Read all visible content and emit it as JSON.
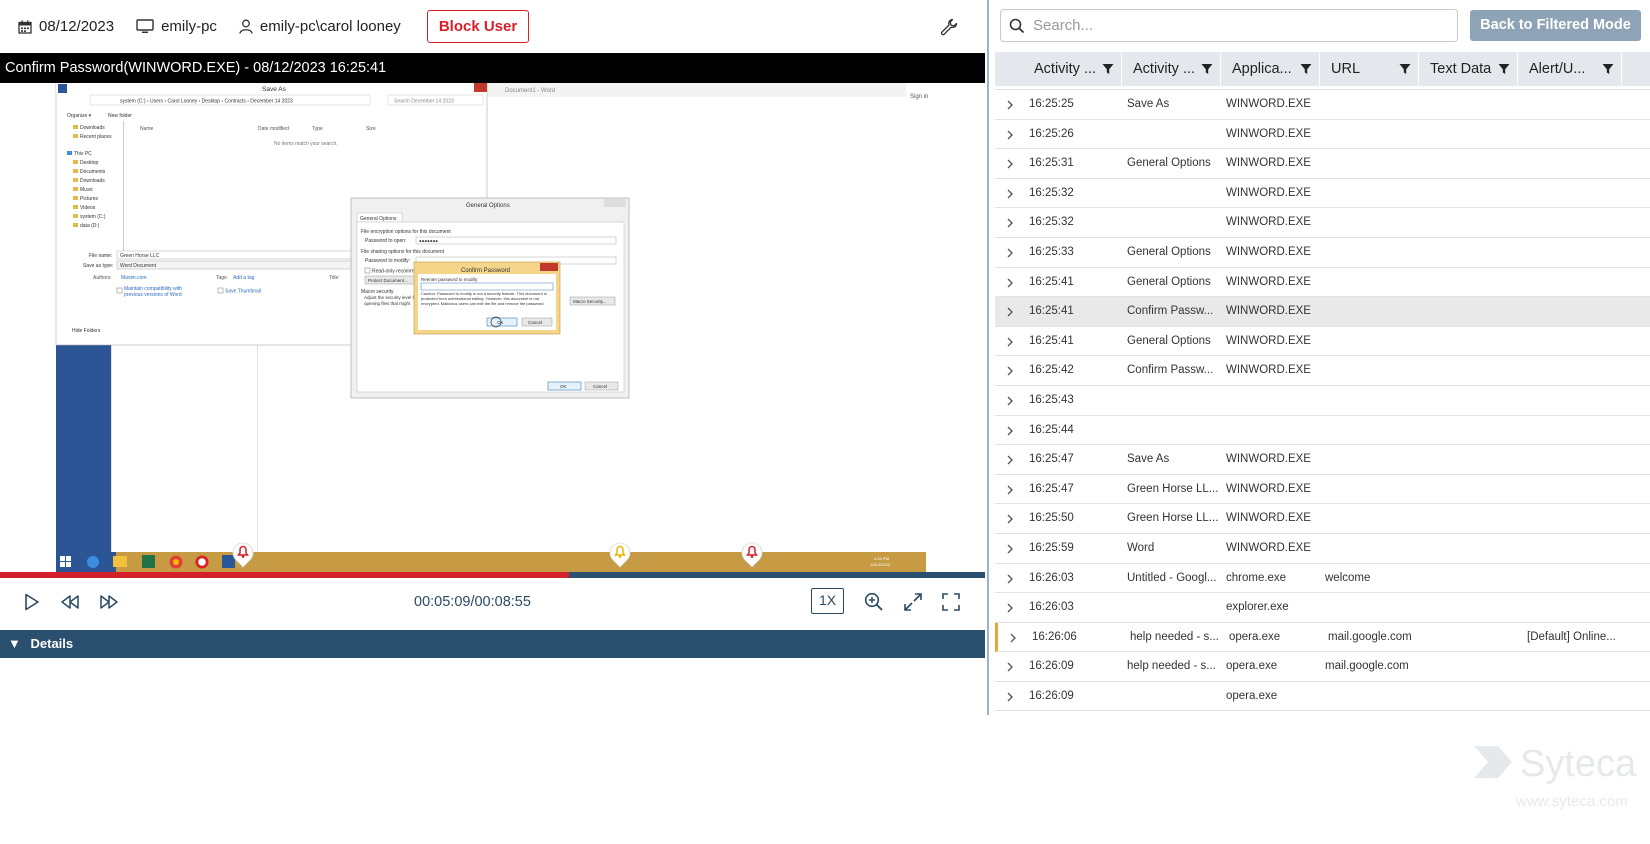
{
  "header": {
    "date": "08/12/2023",
    "computer": "emily-pc",
    "user": "emily-pc\\carol looney",
    "block_user_label": "Block User"
  },
  "player": {
    "title": "Confirm Password(WINWORD.EXE) - 08/12/2023 16:25:41",
    "timecode": "00:05:09/00:08:55",
    "progress_fraction": 0.578,
    "speed": "1X",
    "alert_markers_fraction": [
      0.247,
      0.629,
      0.763
    ]
  },
  "screenshot": {
    "saveas_title": "Save As",
    "path": "system (C:) › Users › Carol Looney › Desktop › Contracts › December 14 2023",
    "search_placeholder": "Search December 14 2023",
    "organize": "Organize ▾",
    "new_folder": "New folder",
    "col_name": "Name",
    "col_date": "Date modified",
    "col_type": "Type",
    "col_size": "Size",
    "empty": "No items match your search.",
    "nav": [
      "Downloads",
      "Recent places",
      "",
      "This PC",
      "Desktop",
      "Documents",
      "Downloads",
      "Music",
      "Pictures",
      "Videos",
      "system (C:)",
      "data (D:)"
    ],
    "file_name_label": "File name:",
    "file_name": "Green Horse LLC",
    "save_type_label": "Save as type:",
    "save_type": "Word Document",
    "authors_label": "Authors:",
    "authors": "Maxim.com",
    "tags_label": "Tags:",
    "tags": "Add a tag",
    "title_label": "Title:",
    "maintain": "Maintain compatibility with previous versions of Word",
    "thumb": "Save Thumbnail",
    "hide": "Hide Folders",
    "go_title": "General Options",
    "go_tab": "General Options",
    "go_enc": "File encryption options for this document",
    "go_pw_open": "Password to open:",
    "go_pw_dots": "●●●●●●●",
    "go_share": "File sharing options for this document",
    "go_pw_modify": "Password to modify:",
    "go_readonly": "Read-only recommended",
    "go_protect": "Protect Document...",
    "go_macro_head": "Macro security",
    "go_macro_text": "Adjust the security level for opening files that might contain macro viruses, and specify the names of trusted macro developers.",
    "go_macro_btn": "Macro Security...",
    "go_ok": "OK",
    "go_cancel": "Cancel",
    "cp_title": "Confirm Password",
    "cp_reenter": "Reenter password to modify:",
    "cp_caution": "Caution: Password to modify is not a security feature. This document is protected from unintentional editing. However, this document is not encrypted. Malicious users can edit the file and remove the password.",
    "cp_ok": "OK",
    "cp_cancel": "Cancel",
    "word_bg_text": "Document1 - Word",
    "signin": "Sign in",
    "tray_time": "4:25 PM",
    "tray_date": "12/14/2023"
  },
  "controls": {
    "details_label": "Details"
  },
  "right": {
    "search_placeholder": "Search...",
    "back_label": "Back to Filtered Mode",
    "columns": [
      "Activity ...",
      "Activity ...",
      "Applica...",
      "URL",
      "Text Data",
      "Alert/U..."
    ],
    "rows": [
      {
        "time": "16:25:25",
        "activity": "Save As",
        "app": "WINWORD.EXE",
        "url": "",
        "text": "",
        "alert": ""
      },
      {
        "time": "16:25:26",
        "activity": "",
        "app": "WINWORD.EXE",
        "url": "",
        "text": "",
        "alert": ""
      },
      {
        "time": "16:25:31",
        "activity": "General Options",
        "app": "WINWORD.EXE",
        "url": "",
        "text": "",
        "alert": ""
      },
      {
        "time": "16:25:32",
        "activity": "",
        "app": "WINWORD.EXE",
        "url": "",
        "text": "",
        "alert": ""
      },
      {
        "time": "16:25:32",
        "activity": "",
        "app": "WINWORD.EXE",
        "url": "",
        "text": "",
        "alert": ""
      },
      {
        "time": "16:25:33",
        "activity": "General Options",
        "app": "WINWORD.EXE",
        "url": "",
        "text": "",
        "alert": ""
      },
      {
        "time": "16:25:41",
        "activity": "General Options",
        "app": "WINWORD.EXE",
        "url": "",
        "text": "",
        "alert": ""
      },
      {
        "time": "16:25:41",
        "activity": "Confirm Passw...",
        "app": "WINWORD.EXE",
        "url": "",
        "text": "",
        "alert": ""
      },
      {
        "time": "16:25:41",
        "activity": "General Options",
        "app": "WINWORD.EXE",
        "url": "",
        "text": "",
        "alert": ""
      },
      {
        "time": "16:25:42",
        "activity": "Confirm Passw...",
        "app": "WINWORD.EXE",
        "url": "",
        "text": "",
        "alert": ""
      },
      {
        "time": "16:25:43",
        "activity": "",
        "app": "",
        "url": "",
        "text": "",
        "alert": ""
      },
      {
        "time": "16:25:44",
        "activity": "",
        "app": "",
        "url": "",
        "text": "",
        "alert": ""
      },
      {
        "time": "16:25:47",
        "activity": "Save As",
        "app": "WINWORD.EXE",
        "url": "",
        "text": "",
        "alert": ""
      },
      {
        "time": "16:25:47",
        "activity": "Green Horse LL...",
        "app": "WINWORD.EXE",
        "url": "",
        "text": "",
        "alert": ""
      },
      {
        "time": "16:25:50",
        "activity": "Green Horse LL...",
        "app": "WINWORD.EXE",
        "url": "",
        "text": "",
        "alert": ""
      },
      {
        "time": "16:25:59",
        "activity": "Word",
        "app": "WINWORD.EXE",
        "url": "",
        "text": "",
        "alert": ""
      },
      {
        "time": "16:26:03",
        "activity": "Untitled - Googl...",
        "app": "chrome.exe",
        "url": "welcome",
        "text": "",
        "alert": ""
      },
      {
        "time": "16:26:03",
        "activity": "",
        "app": "explorer.exe",
        "url": "",
        "text": "",
        "alert": ""
      },
      {
        "time": "16:26:06",
        "activity": "help needed - s...",
        "app": "opera.exe",
        "url": "mail.google.com",
        "text": "",
        "alert": "[Default] Online..."
      },
      {
        "time": "16:26:09",
        "activity": "help needed - s...",
        "app": "opera.exe",
        "url": "mail.google.com",
        "text": "",
        "alert": ""
      },
      {
        "time": "16:26:09",
        "activity": "",
        "app": "opera.exe",
        "url": "",
        "text": "",
        "alert": ""
      }
    ],
    "selected_row_index": 7,
    "flagged_row_index": 18
  },
  "watermark": {
    "brand": "Syteca",
    "url": "www.syteca.com"
  },
  "colors": {
    "block_red": "#d9202a",
    "navy": "#2b4f6e",
    "back_button": "#8ea3b5",
    "progress_red": "#d4202a",
    "flag_orange": "#f0a23a"
  }
}
